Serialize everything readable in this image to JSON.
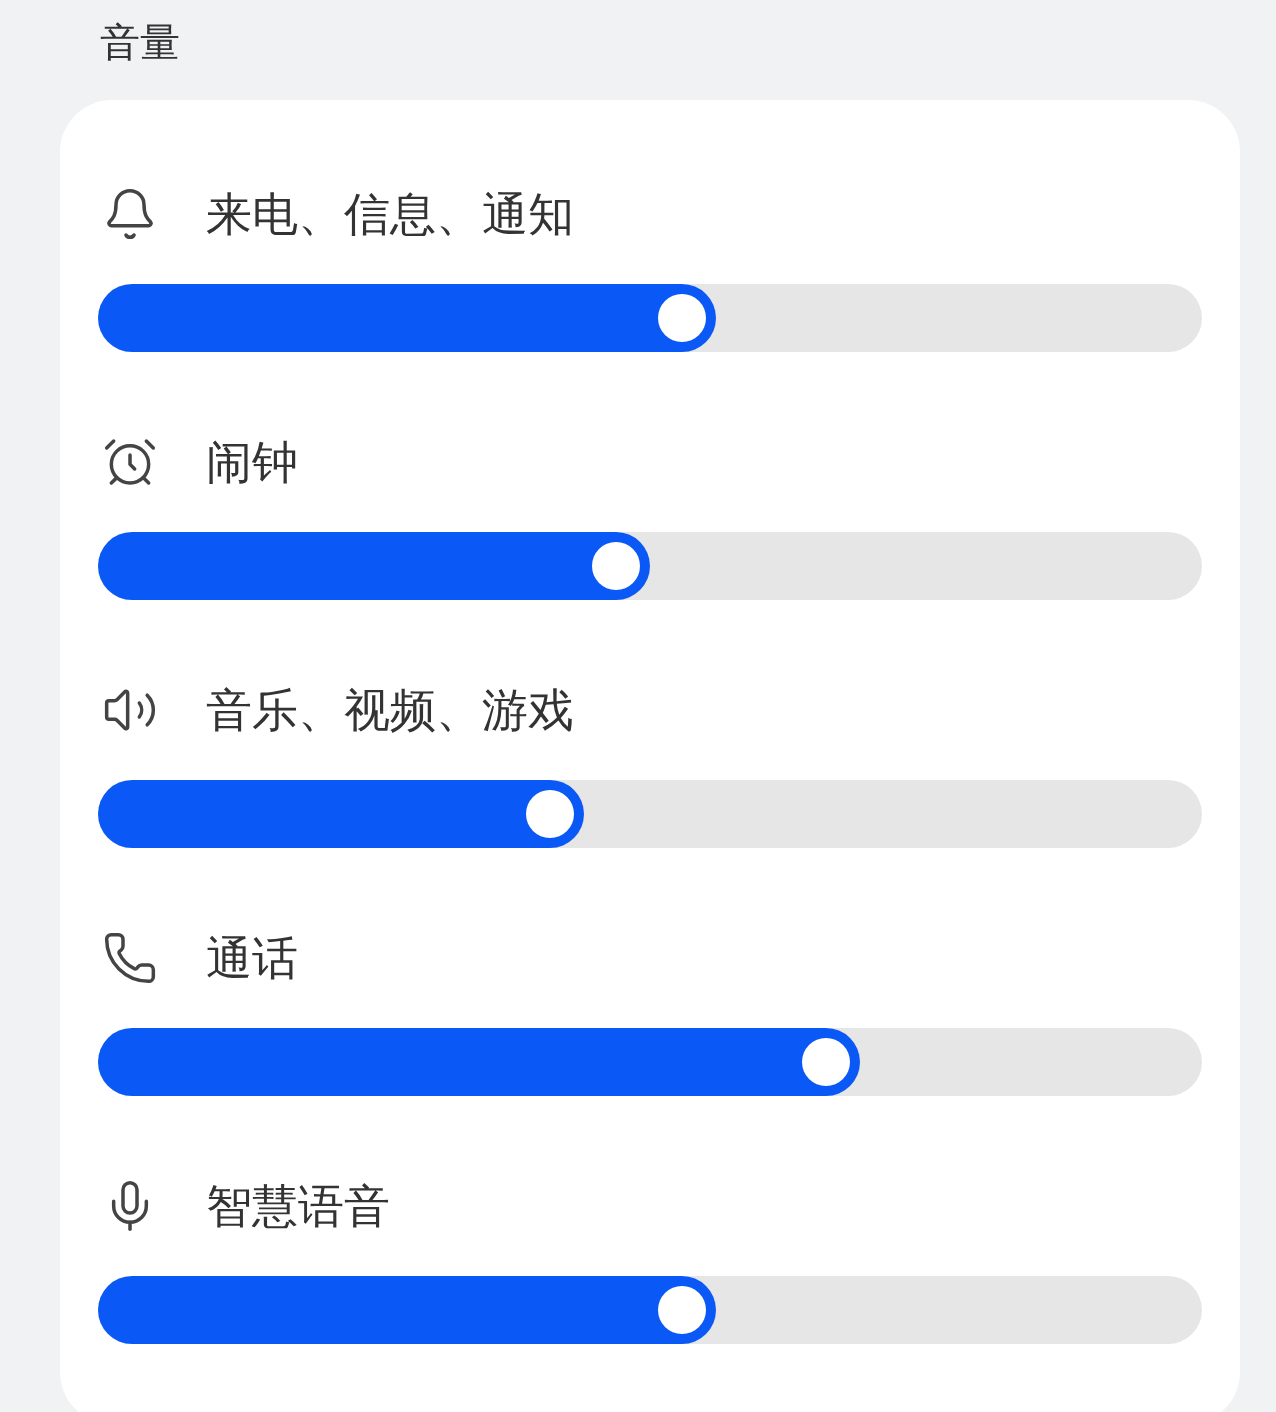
{
  "section_title": "音量",
  "channels": [
    {
      "name": "来电、信息、通知",
      "level": 0.56
    },
    {
      "name": "闹钟",
      "level": 0.5
    },
    {
      "name": "音乐、视频、游戏",
      "level": 0.44
    },
    {
      "name": "通话",
      "level": 0.69
    },
    {
      "name": "智慧语音",
      "level": 0.56
    }
  ]
}
